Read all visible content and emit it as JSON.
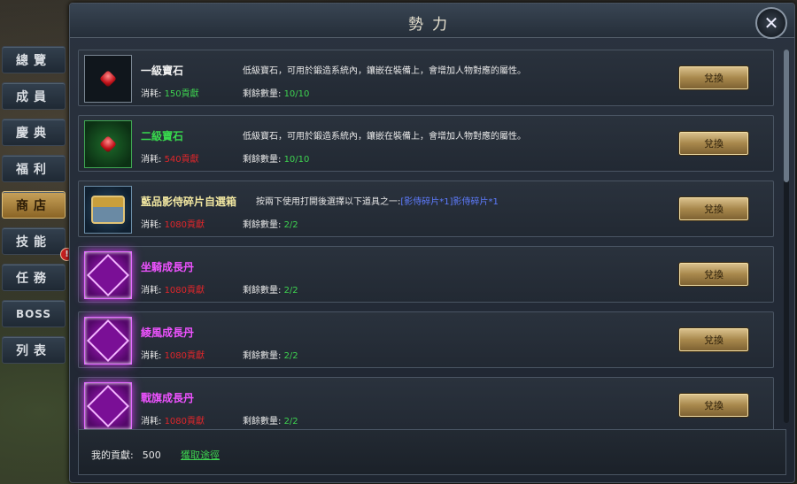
{
  "side_tabs": [
    {
      "label": "總覽",
      "active": false
    },
    {
      "label": "成員",
      "active": false
    },
    {
      "label": "慶典",
      "active": false
    },
    {
      "label": "福利",
      "active": false
    },
    {
      "label": "商店",
      "active": true
    },
    {
      "label": "技能",
      "active": false
    },
    {
      "label": "任務",
      "active": false,
      "alert": "!"
    },
    {
      "label": "BOSS",
      "active": false
    },
    {
      "label": "列表",
      "active": false
    }
  ],
  "panel": {
    "title": "勢力",
    "close_icon": "close-icon"
  },
  "items": [
    {
      "name": "一級寶石",
      "name_color": "white",
      "icon": "red-gem-icon",
      "desc": "低級寶石，可用於鍛造系統內，鑲嵌在裝備上，會增加人物對應的屬性。",
      "cost_label": "消耗:",
      "cost_value": "150貢獻",
      "cost_color": "green",
      "remain_label": "剩餘數量:",
      "remain_value": "10/10",
      "button": "兌換"
    },
    {
      "name": "二級寶石",
      "name_color": "green",
      "icon": "red-gem-icon",
      "desc": "低級寶石，可用於鍛造系統內，鑲嵌在裝備上，會增加人物對應的屬性。",
      "cost_label": "消耗:",
      "cost_value": "540貢獻",
      "cost_color": "red",
      "remain_label": "剩餘數量:",
      "remain_value": "10/10",
      "button": "兌換"
    },
    {
      "name": "藍品影侍碎片自選箱",
      "name_color": "yellow",
      "icon": "chest-icon",
      "desc": "按兩下使用打開後選擇以下道具之一:",
      "desc_extra": "[影侍碎片*1]影侍碎片*1",
      "cost_label": "消耗:",
      "cost_value": "1080貢獻",
      "cost_color": "red",
      "remain_label": "剩餘數量:",
      "remain_value": "2/2",
      "button": "兌換"
    },
    {
      "name": "坐騎成長丹",
      "name_color": "purple",
      "icon": "mount-pill-icon",
      "desc": "",
      "cost_label": "消耗:",
      "cost_value": "1080貢獻",
      "cost_color": "red",
      "remain_label": "剩餘數量:",
      "remain_value": "2/2",
      "button": "兌換"
    },
    {
      "name": "綾風成長丹",
      "name_color": "purple",
      "icon": "wing-pill-icon",
      "desc": "",
      "cost_label": "消耗:",
      "cost_value": "1080貢獻",
      "cost_color": "red",
      "remain_label": "剩餘數量:",
      "remain_value": "2/2",
      "button": "兌換"
    },
    {
      "name": "戰旗成長丹",
      "name_color": "purple",
      "icon": "banner-pill-icon",
      "desc": "",
      "cost_label": "消耗:",
      "cost_value": "1080貢獻",
      "cost_color": "red",
      "remain_label": "剩餘數量:",
      "remain_value": "2/2",
      "button": "兌換"
    }
  ],
  "footer": {
    "contribution_label": "我的貢獻:",
    "contribution_value": "500",
    "how_to_get": "獲取途徑"
  }
}
